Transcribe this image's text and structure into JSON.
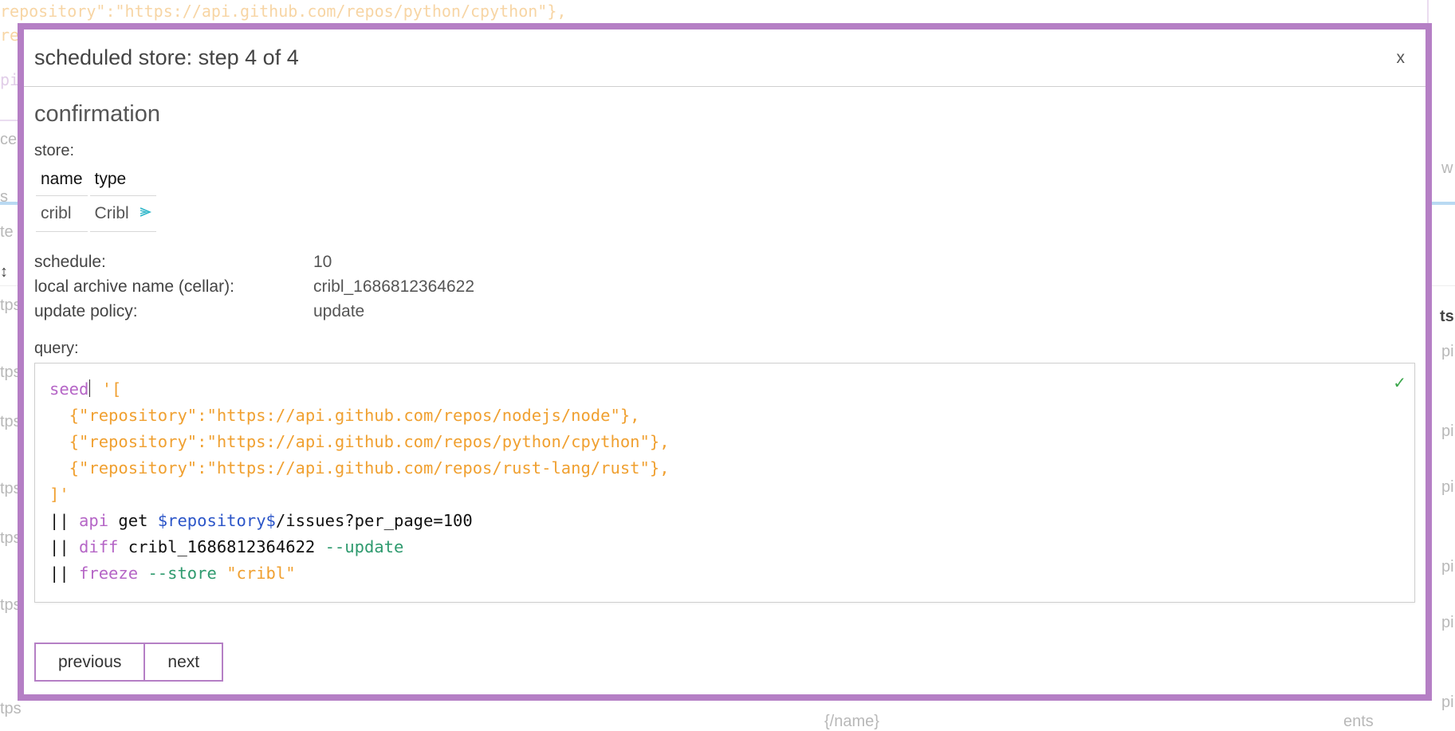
{
  "background": {
    "code_lines": [
      "repository\":\"https://api.github.com/repos/python/cpython\"},",
      "re",
      "pi"
    ],
    "ghost_texts": [
      "cel",
      "s",
      "te",
      "tps",
      "tps",
      "tps",
      "tps",
      "tps",
      "tps",
      "tps",
      "{/name}",
      "ents",
      "pi",
      "pi",
      "pi",
      "pi",
      "pi",
      "pi",
      "w",
      "ts",
      "↕"
    ]
  },
  "modal": {
    "title": "scheduled store: step 4 of 4",
    "close_label": "x",
    "section_title": "confirmation",
    "store_label": "store:",
    "store_table": {
      "headers": [
        "name",
        "type"
      ],
      "rows": [
        {
          "name": "cribl",
          "type": "Cribl",
          "type_icon": "cribl-logo-icon"
        }
      ]
    },
    "details": [
      {
        "key": "schedule:",
        "value": "10"
      },
      {
        "key": "local archive name (cellar):",
        "value": "cribl_1686812364622"
      },
      {
        "key": "update policy:",
        "value": "update"
      }
    ],
    "query_label": "query:",
    "query_status_icon": "check-icon",
    "query_status_glyph": "✓",
    "query_lines": {
      "l1_kw": "seed",
      "l1_str": " '[",
      "l2": "  {\"repository\":\"https://api.github.com/repos/nodejs/node\"},",
      "l3": "  {\"repository\":\"https://api.github.com/repos/python/cpython\"},",
      "l4": "  {\"repository\":\"https://api.github.com/repos/rust-lang/rust\"},",
      "l5": "]'",
      "l6_pipe": "|| ",
      "l6_kw": "api",
      "l6_plain": " get ",
      "l6_var": "$repository$",
      "l6_rest": "/issues?per_page=100",
      "l7_pipe": "|| ",
      "l7_kw": "diff",
      "l7_plain": " cribl_1686812364622 ",
      "l7_flag": "--update",
      "l8_pipe": "|| ",
      "l8_kw": "freeze",
      "l8_space": " ",
      "l8_flag": "--store",
      "l8_space2": " ",
      "l8_str": "\"cribl\""
    },
    "buttons": {
      "previous": "previous",
      "next": "next"
    }
  },
  "colors": {
    "accent": "#b57fc5",
    "keyword": "#b565c6",
    "string": "#f0a030",
    "variable": "#2b55c8",
    "flag": "#2e9a6e",
    "cribl_icon": "#2bb5c8"
  }
}
